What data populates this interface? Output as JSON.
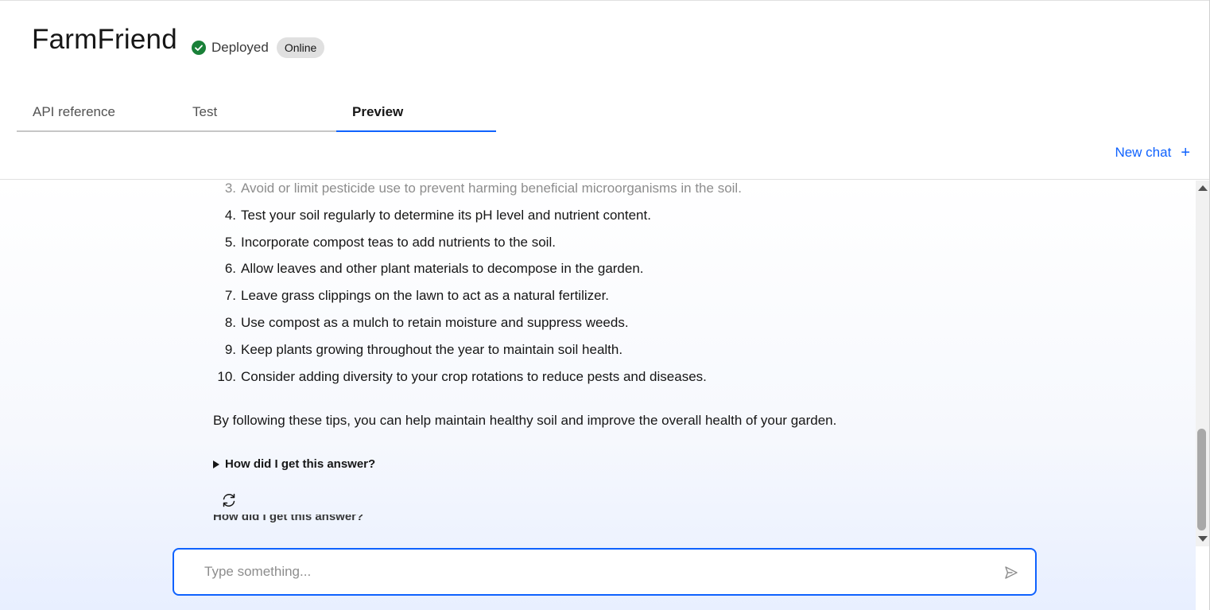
{
  "app": {
    "title": "FarmFriend",
    "status": "Deployed",
    "badge": "Online"
  },
  "tabs": [
    {
      "label": "API reference",
      "active": false
    },
    {
      "label": "Test",
      "active": false
    },
    {
      "label": "Preview",
      "active": true
    }
  ],
  "new_chat": {
    "label": "New chat",
    "icon": "plus-icon"
  },
  "answer": {
    "items": [
      {
        "num": "3.",
        "text": "Avoid or limit pesticide use to prevent harming beneficial microorganisms in the soil."
      },
      {
        "num": "4.",
        "text": "Test your soil regularly to determine its pH level and nutrient content."
      },
      {
        "num": "5.",
        "text": "Incorporate compost teas to add nutrients to the soil."
      },
      {
        "num": "6.",
        "text": "Allow leaves and other plant materials to decompose in the garden."
      },
      {
        "num": "7.",
        "text": "Leave grass clippings on the lawn to act as a natural fertilizer."
      },
      {
        "num": "8.",
        "text": "Use compost as a mulch to retain moisture and suppress weeds."
      },
      {
        "num": "9.",
        "text": "Keep plants growing throughout the year to maintain soil health."
      },
      {
        "num": "10.",
        "text": "Consider adding diversity to your crop rotations to reduce pests and diseases."
      }
    ],
    "closing": "By following these tips, you can help maintain healthy soil and improve the overall health of your garden.",
    "details_label": "How did I get this answer?",
    "ghost_details_label": "How did I get this answer?"
  },
  "input": {
    "placeholder": "Type something...",
    "value": ""
  },
  "colors": {
    "accent": "#0f62fe",
    "success": "#24a148",
    "badge_bg": "#e0e0e0"
  }
}
